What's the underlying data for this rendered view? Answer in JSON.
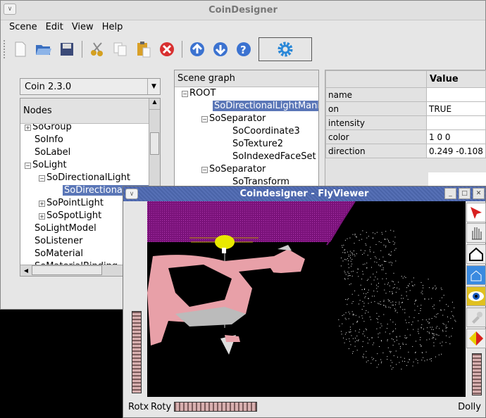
{
  "main": {
    "title": "CoinDesigner",
    "menu": [
      "Scene",
      "Edit",
      "View",
      "Help"
    ]
  },
  "toolbar": {
    "icons": [
      "new-file-icon",
      "open-folder-icon",
      "save-icon",
      "cut-icon",
      "copy-icon",
      "paste-icon",
      "delete-icon",
      "move-up-icon",
      "move-down-icon",
      "help-icon",
      "gear-icon"
    ]
  },
  "combo": {
    "value": "Coin 2.3.0"
  },
  "nodes": {
    "header": "Nodes",
    "items": [
      "SoGroup",
      "SoInfo",
      "SoLabel",
      "SoLight",
      "SoDirectionalLight",
      "SoDirectionalLightManip",
      "SoPointLight",
      "SoSpotLight",
      "SoLightModel",
      "SoListener",
      "SoMaterial",
      "SoMaterialBinding"
    ]
  },
  "scene": {
    "header": "Scene graph",
    "items": [
      "ROOT",
      "SoDirectionalLightManip",
      "SoSeparator",
      "SoCoordinate3",
      "SoTexture2",
      "SoIndexedFaceSet",
      "SoSeparator",
      "SoTransform"
    ]
  },
  "props": {
    "header": "Value",
    "rows": [
      {
        "k": "name",
        "v": ""
      },
      {
        "k": "on",
        "v": "TRUE"
      },
      {
        "k": "intensity",
        "v": ""
      },
      {
        "k": "color",
        "v": "1 0 0"
      },
      {
        "k": "direction",
        "v": "0.249 -0.108"
      }
    ]
  },
  "viewer": {
    "title": "Coindesigner - FlyViewer",
    "rotx": "Rotx",
    "roty": "Roty",
    "dolly": "Dolly",
    "buttons": [
      "pick-arrow-icon",
      "hand-view-icon",
      "home-icon",
      "set-home-icon",
      "view-all-eye-icon",
      "seek-icon",
      "projection-cube-icon"
    ]
  }
}
